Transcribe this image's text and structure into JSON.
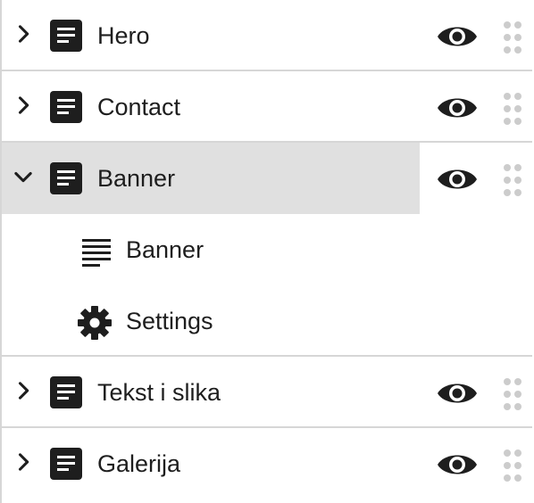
{
  "rows": [
    {
      "label": "Hero",
      "expanded": false,
      "icon": "document-icon"
    },
    {
      "label": "Contact",
      "expanded": false,
      "icon": "document-icon"
    },
    {
      "label": "Banner",
      "expanded": true,
      "icon": "document-icon",
      "children": [
        {
          "label": "Banner",
          "icon": "text-lines-icon"
        },
        {
          "label": "Settings",
          "icon": "gear-icon"
        }
      ]
    },
    {
      "label": "Tekst i slika",
      "expanded": false,
      "icon": "document-icon"
    },
    {
      "label": "Galerija",
      "expanded": false,
      "icon": "document-icon"
    }
  ],
  "colors": {
    "text": "#1e1e1e",
    "border": "#d6d6d6",
    "selected_bg": "#e0e0e0",
    "drag_dots": "#cccccc"
  }
}
